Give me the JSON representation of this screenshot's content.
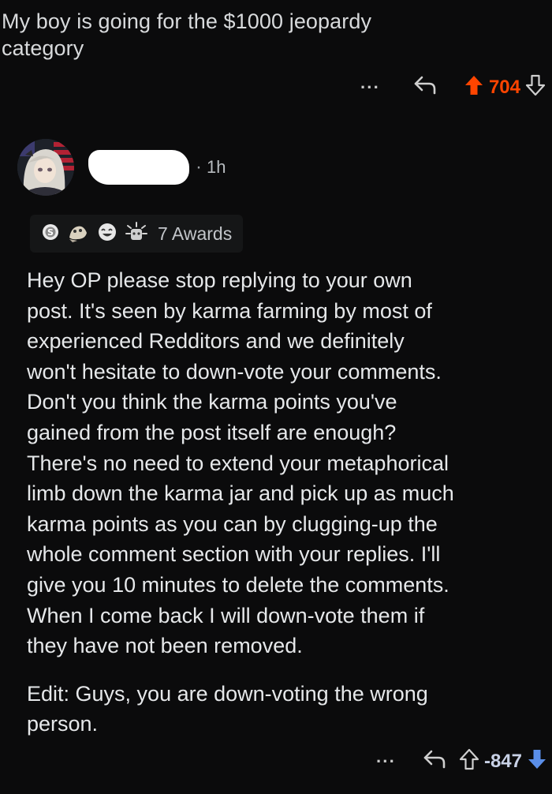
{
  "parent_comment": {
    "text": "My boy is going for the $1000 jeopardy\ncategory",
    "actions": {
      "more": "···",
      "score": "704"
    }
  },
  "comment": {
    "time": "1h",
    "separator": "·",
    "awards_label": "7 Awards",
    "body": "Hey OP please stop replying to your own\npost. It's seen by karma farming by most of\nexperienced Redditors and we definitely\nwon't hesitate to down-vote your comments.\nDon't you think the karma points you've\ngained from the post itself are enough?\nThere's no need to extend your metaphorical\nlimb down the karma jar and pick up as much\nkarma points as you can by clugging-up the\nwhole comment section with your replies. I'll\ngive you 10 minutes to delete the comments.\nWhen I come back I will down-vote them if\nthey have not been removed.",
    "edit": "Edit: Guys, you are down-voting the wrong\nperson.",
    "actions": {
      "more": "···",
      "score": "-847"
    }
  },
  "colors": {
    "background": "#0b0b0c",
    "upvote": "#ff4500",
    "downvote": "#5a8ee8"
  }
}
